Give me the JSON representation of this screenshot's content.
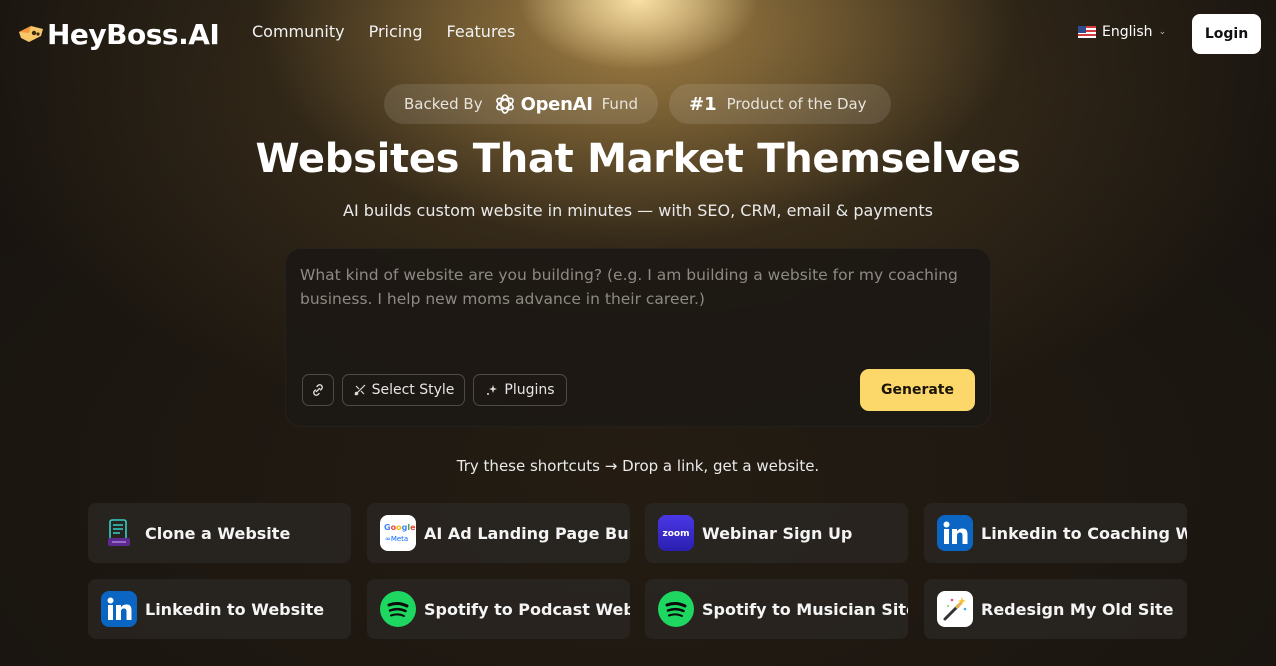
{
  "nav": {
    "brand": "HeyBoss.AI",
    "links": [
      "Community",
      "Pricing",
      "Features"
    ],
    "language": "English",
    "login_label": "Login"
  },
  "badges": {
    "backed_prefix": "Backed By",
    "backed_brand": "OpenAI",
    "backed_suffix": "Fund",
    "rank": "#1",
    "rank_text": "Product of the Day"
  },
  "hero": {
    "title": "Websites That Market Themselves",
    "subtitle": "AI builds custom website in minutes — with SEO, CRM, email & payments"
  },
  "prompt": {
    "placeholder": "What kind of website are you building? (e.g. I am building a website for my coaching business. I help new moms advance in their career.)",
    "value": "",
    "select_style_label": "Select Style",
    "plugins_label": "Plugins",
    "generate_label": "Generate"
  },
  "shortcuts": {
    "hint": "Try these shortcuts → Drop a link, get a website.",
    "items": [
      {
        "label": "Clone a Website",
        "icon": "clone-website-icon"
      },
      {
        "label": "AI Ad Landing Page Builder",
        "icon": "google-meta-ads-icon"
      },
      {
        "label": "Webinar Sign Up",
        "icon": "zoom-icon"
      },
      {
        "label": "Linkedin to Coaching Website",
        "icon": "linkedin-icon"
      },
      {
        "label": "Linkedin to Website",
        "icon": "linkedin-icon"
      },
      {
        "label": "Spotify to Podcast Website",
        "icon": "spotify-icon"
      },
      {
        "label": "Spotify to Musician Site",
        "icon": "spotify-icon"
      },
      {
        "label": "Redesign My Old Site",
        "icon": "magic-wand-icon"
      }
    ]
  },
  "colors": {
    "accent": "#fcd769",
    "spotify": "#1ed760",
    "linkedin": "#0a66c2",
    "zoom": "#3b2fd6"
  }
}
